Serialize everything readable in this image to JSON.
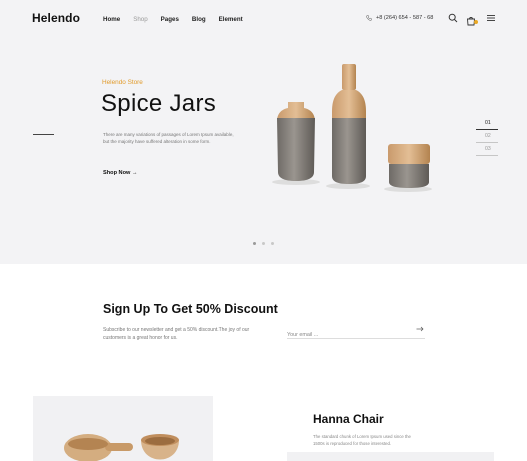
{
  "header": {
    "logo": "Helendo",
    "nav": [
      {
        "label": "Home",
        "active": false
      },
      {
        "label": "Shop",
        "active": true
      },
      {
        "label": "Pages",
        "active": false
      },
      {
        "label": "Blog",
        "active": false
      },
      {
        "label": "Element",
        "active": false
      }
    ],
    "phone": "+8 (264) 654 - 587 - 68",
    "icons": [
      "search-icon",
      "cart-icon",
      "menu-icon"
    ],
    "cart_badge_color": "#e9a825"
  },
  "hero": {
    "eyebrow": "Helendo Store",
    "title": "Spice Jars",
    "description": "There are many variations of passages of Lorem Ipsum available, but the majority have suffered alteration in some form.",
    "cta": "Shop Now →",
    "slides": [
      "01",
      "02",
      "03"
    ],
    "active_slide": 0,
    "dots": 3,
    "active_dot": 0,
    "accent": "#e19b2b"
  },
  "newsletter": {
    "title": "Sign Up To Get 50% Discount",
    "description": "Subscribe to our newsletter and get a 50% discount.The joy of our customers is a great honor for us.",
    "email_placeholder": "Your email ..."
  },
  "product": {
    "title": "Hanna Chair",
    "description": "The standard chunk of Lorem Ipsum used since the 1500s is reproduced for those interested."
  }
}
